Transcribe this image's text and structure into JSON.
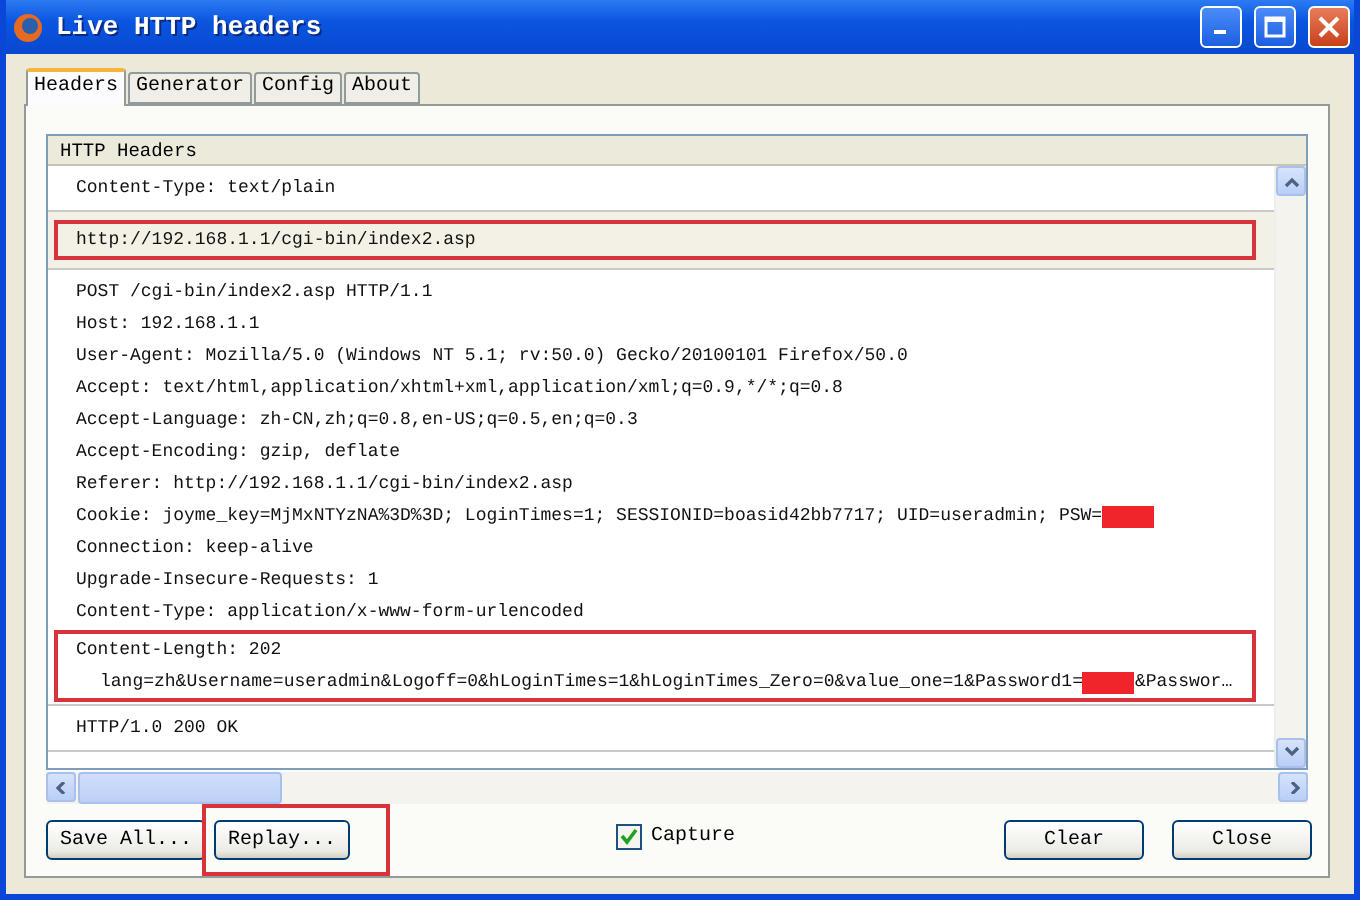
{
  "window": {
    "title": "Live HTTP headers"
  },
  "tabs": [
    {
      "label": "Headers",
      "selected": true
    },
    {
      "label": "Generator",
      "selected": false
    },
    {
      "label": "Config",
      "selected": false
    },
    {
      "label": "About",
      "selected": false
    }
  ],
  "headers_list": {
    "heading": "HTTP Headers",
    "entries": [
      {
        "selected": false,
        "blocks": [
          {
            "framed": false,
            "lines": [
              {
                "indented": false,
                "parts": [
                  {
                    "kind": "text",
                    "text": "Content-Type: text/plain"
                  }
                ]
              }
            ]
          }
        ]
      },
      {
        "selected": true,
        "blocks": [
          {
            "framed": true,
            "lines": [
              {
                "indented": false,
                "parts": [
                  {
                    "kind": "text",
                    "text": "http://192.168.1.1/cgi-bin/index2.asp"
                  }
                ]
              }
            ]
          }
        ]
      },
      {
        "selected": false,
        "blocks": [
          {
            "framed": false,
            "lines": [
              {
                "indented": false,
                "parts": [
                  {
                    "kind": "text",
                    "text": "POST /cgi-bin/index2.asp HTTP/1.1"
                  }
                ]
              },
              {
                "indented": false,
                "parts": [
                  {
                    "kind": "text",
                    "text": "Host: 192.168.1.1"
                  }
                ]
              },
              {
                "indented": false,
                "parts": [
                  {
                    "kind": "text",
                    "text": "User-Agent: Mozilla/5.0 (Windows NT 5.1; rv:50.0) Gecko/20100101 Firefox/50.0"
                  }
                ]
              },
              {
                "indented": false,
                "parts": [
                  {
                    "kind": "text",
                    "text": "Accept: text/html,application/xhtml+xml,application/xml;q=0.9,*/*;q=0.8"
                  }
                ]
              },
              {
                "indented": false,
                "parts": [
                  {
                    "kind": "text",
                    "text": "Accept-Language: zh-CN,zh;q=0.8,en-US;q=0.5,en;q=0.3"
                  }
                ]
              },
              {
                "indented": false,
                "parts": [
                  {
                    "kind": "text",
                    "text": "Accept-Encoding: gzip, deflate"
                  }
                ]
              },
              {
                "indented": false,
                "parts": [
                  {
                    "kind": "text",
                    "text": "Referer: http://192.168.1.1/cgi-bin/index2.asp"
                  }
                ]
              },
              {
                "indented": false,
                "parts": [
                  {
                    "kind": "text",
                    "text": "Cookie: joyme_key=MjMxNTYzNA%3D%3D; LoginTimes=1; SESSIONID=boasid42bb7717; UID=useradmin; PSW="
                  },
                  {
                    "kind": "redaction"
                  }
                ]
              },
              {
                "indented": false,
                "parts": [
                  {
                    "kind": "text",
                    "text": "Connection: keep-alive"
                  }
                ]
              },
              {
                "indented": false,
                "parts": [
                  {
                    "kind": "text",
                    "text": "Upgrade-Insecure-Requests: 1"
                  }
                ]
              },
              {
                "indented": false,
                "parts": [
                  {
                    "kind": "text",
                    "text": "Content-Type: application/x-www-form-urlencoded"
                  }
                ]
              }
            ]
          },
          {
            "framed": true,
            "lines": [
              {
                "indented": false,
                "parts": [
                  {
                    "kind": "text",
                    "text": "Content-Length: 202"
                  }
                ]
              },
              {
                "indented": true,
                "parts": [
                  {
                    "kind": "text",
                    "text": "lang=zh&Username=useradmin&Logoff=0&hLoginTimes=1&hLoginTimes_Zero=0&value_one=1&Password1="
                  },
                  {
                    "kind": "redaction"
                  },
                  {
                    "kind": "text",
                    "text": "&Passwor…"
                  }
                ]
              }
            ]
          }
        ]
      },
      {
        "selected": false,
        "blocks": [
          {
            "framed": false,
            "lines": [
              {
                "indented": false,
                "parts": [
                  {
                    "kind": "text",
                    "text": "HTTP/1.0 200 OK"
                  }
                ]
              }
            ]
          }
        ]
      }
    ]
  },
  "buttons": [
    {
      "kind": "left",
      "label": "Save All...",
      "highlighted": false
    },
    {
      "kind": "left",
      "label": "Replay...",
      "highlighted": true
    },
    {
      "kind": "right",
      "label": "Clear",
      "highlighted": false
    },
    {
      "kind": "right",
      "label": "Close",
      "highlighted": false
    }
  ],
  "capture": {
    "label": "Capture",
    "checked": true
  }
}
